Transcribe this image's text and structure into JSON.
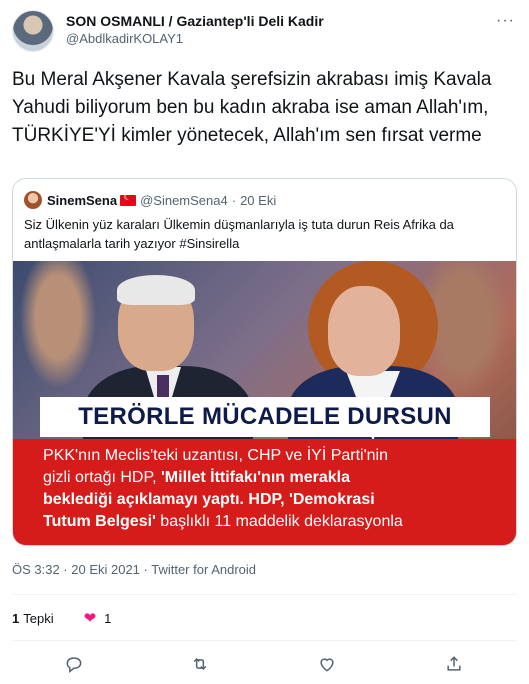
{
  "author": {
    "display_name": "SON OSMANLI / Gaziantep'li Deli Kadir",
    "handle": "@AbdlkadirKOLAY1",
    "more_label": "···"
  },
  "tweet": {
    "text": "Bu Meral Akşener Kavala şerefsizin akrabası imiş Kavala Yahudi biliyorum ben bu kadın akraba ise aman Allah'ım, TÜRKİYE'Yİ kimler yönetecek, Allah'ım sen fırsat verme"
  },
  "quoted": {
    "name": "SinemSena",
    "handle": "@SinemSena4",
    "dot": "·",
    "date": "20 Eki",
    "text": "Siz Ülkenin yüz karaları Ülkemin düşmanlarıyla iş tuta durun Reis Afrika da antlaşmalarla tarih yazıyor #Sinsirella",
    "media": {
      "headline": "TERÖRLE MÜCADELE DURSUN",
      "body_line1": "PKK'nın Meclis'teki uzantısı, CHP ve İYİ Parti'nin",
      "body_line2a": "gizli ortağı HDP, ",
      "body_line2b": "'Millet İttifakı'nın merakla",
      "body_line3": "beklediği açıklamayı yaptı. HDP, 'Demokrasi",
      "body_line4a": "Tutum Belgesi'",
      "body_line4b": " başlıklı 11 maddelik deklarasyonla"
    }
  },
  "meta": {
    "line": "ÖS 3:32 · 20 Eki 2021 · Twitter for Android"
  },
  "stats": {
    "quote_count": "1",
    "quote_label": "Tepki",
    "like_count": "1"
  },
  "colors": {
    "text": "#0f1419",
    "secondary": "#536471",
    "like": "#f91880",
    "border": "#cfd9de",
    "banner_red": "#d61b1b"
  },
  "icons": [
    "more-icon",
    "reply-icon",
    "retweet-icon",
    "like-icon",
    "share-icon",
    "heart-filled-icon"
  ]
}
